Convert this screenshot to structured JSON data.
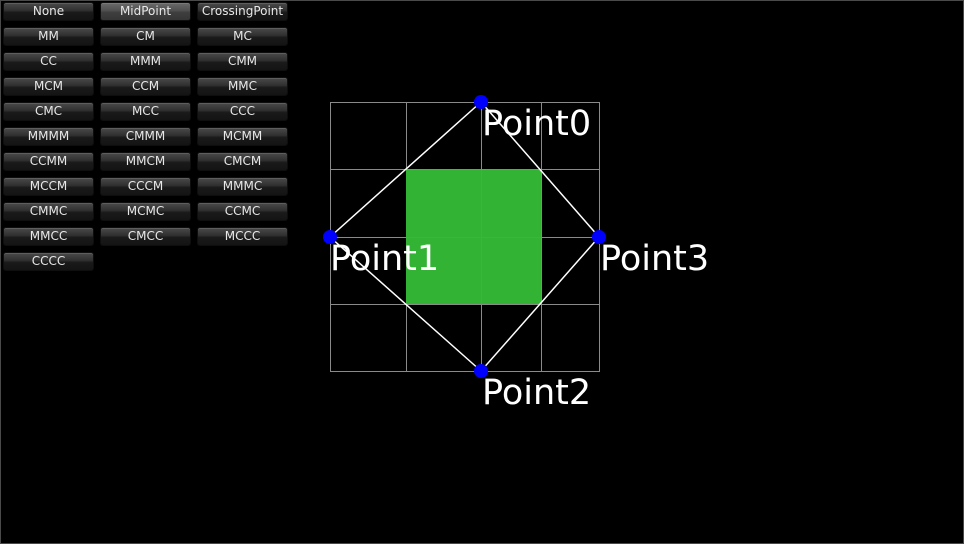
{
  "buttons": [
    {
      "label": "None"
    },
    {
      "label": "MidPoint",
      "selected": true
    },
    {
      "label": "CrossingPoint"
    },
    {
      "label": "MM"
    },
    {
      "label": "CM"
    },
    {
      "label": "MC"
    },
    {
      "label": "CC"
    },
    {
      "label": "MMM"
    },
    {
      "label": "CMM"
    },
    {
      "label": "MCM"
    },
    {
      "label": "CCM"
    },
    {
      "label": "MMC"
    },
    {
      "label": "CMC"
    },
    {
      "label": "MCC"
    },
    {
      "label": "CCC"
    },
    {
      "label": "MMMM"
    },
    {
      "label": "CMMM"
    },
    {
      "label": "MCMM"
    },
    {
      "label": "CCMM"
    },
    {
      "label": "MMCM"
    },
    {
      "label": "CMCM"
    },
    {
      "label": "MCCM"
    },
    {
      "label": "CCCM"
    },
    {
      "label": "MMMC"
    },
    {
      "label": "CMMC"
    },
    {
      "label": "MCMC"
    },
    {
      "label": "CCMC"
    },
    {
      "label": "MMCC"
    },
    {
      "label": "CMCC"
    },
    {
      "label": "MCCC"
    },
    {
      "label": "CCCC"
    }
  ],
  "points": {
    "p0": "Point0",
    "p1": "Point1",
    "p2": "Point2",
    "p3": "Point3"
  },
  "colors": {
    "background": "#000000",
    "grid": "#8a8a8a",
    "fill": "#33b333",
    "handle": "#0000ff",
    "outline": "#ffffff",
    "label": "#ffffff"
  }
}
